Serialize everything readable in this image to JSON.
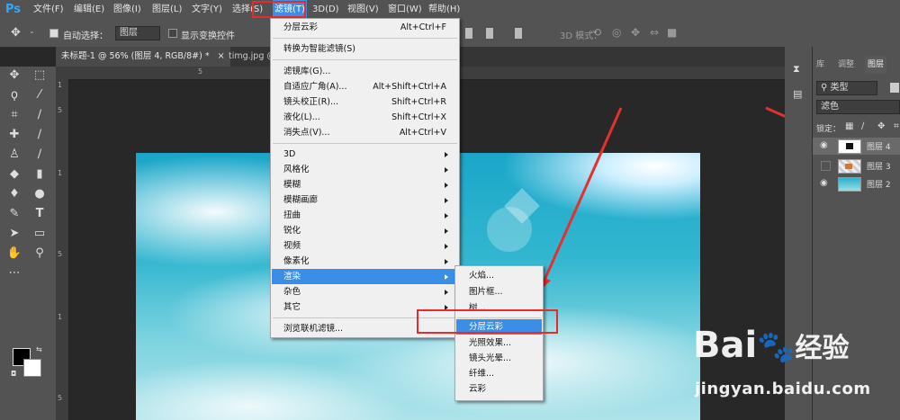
{
  "app": {
    "logo": "Ps"
  },
  "menubar": {
    "items": [
      "文件(F)",
      "编辑(E)",
      "图像(I)",
      "图层(L)",
      "文字(Y)",
      "选择(S)",
      "滤镜(T)",
      "3D(D)",
      "视图(V)",
      "窗口(W)",
      "帮助(H)"
    ],
    "highlight_color": "#e52b2b"
  },
  "options_bar": {
    "auto_select_label": "自动选择：",
    "auto_select_value": "图层",
    "show_transform_label": "显示变换控件",
    "mode_3d_label": "3D 模式："
  },
  "tabs": [
    {
      "label": "未标题-1 @ 56% (图层 4, RGB/8#) *",
      "close": "×",
      "active": true
    },
    {
      "label": "timg.jpg @",
      "close": "",
      "active": false
    }
  ],
  "rulers": {
    "top_tick": "5",
    "left_ticks": [
      "1",
      "5",
      "1",
      "5",
      "1",
      "5"
    ]
  },
  "filter_menu": {
    "last_filter": "分层云彩",
    "last_filter_shortcut": "Alt+Ctrl+F",
    "convert_smart": "转换为智能滤镜(S)",
    "gallery_items": [
      {
        "label": "滤镜库(G)...",
        "shortcut": ""
      },
      {
        "label": "自适应广角(A)...",
        "shortcut": "Alt+Shift+Ctrl+A"
      },
      {
        "label": "镜头校正(R)...",
        "shortcut": "Shift+Ctrl+R"
      },
      {
        "label": "液化(L)...",
        "shortcut": "Shift+Ctrl+X"
      },
      {
        "label": "消失点(V)...",
        "shortcut": "Alt+Ctrl+V"
      }
    ],
    "submenus": [
      "3D",
      "风格化",
      "模糊",
      "模糊画廊",
      "扭曲",
      "锐化",
      "视频",
      "像素化",
      "渲染",
      "杂色",
      "其它"
    ],
    "highlighted_submenu": "渲染",
    "browse_online": "浏览联机滤镜..."
  },
  "render_submenu": {
    "items": [
      "火焰...",
      "图片框...",
      "树...",
      "分层云彩",
      "光照效果...",
      "镜头光晕...",
      "纤维...",
      "云彩"
    ],
    "highlighted": "分层云彩"
  },
  "layers_panel": {
    "tabs": [
      "库",
      "调整",
      "图层"
    ],
    "active_tab": "图层",
    "kind_filter": "类型",
    "blend_mode": "滤色",
    "lock_label": "锁定：",
    "layers": [
      {
        "name": "图层 4",
        "visible": true,
        "selected": true
      },
      {
        "name": "图层 3",
        "visible": false,
        "selected": false
      },
      {
        "name": "图层 2",
        "visible": true,
        "selected": false
      }
    ]
  },
  "watermark": {
    "brand": "Bai",
    "brand2": "经验",
    "url": "jingyan.baidu.com"
  }
}
